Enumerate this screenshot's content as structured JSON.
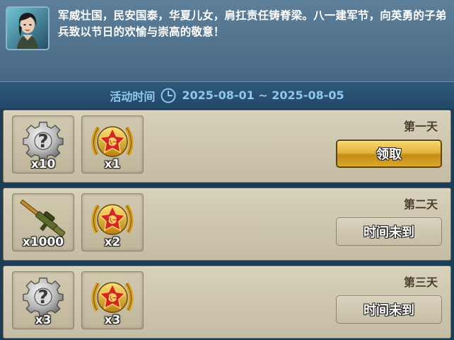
{
  "header": {
    "intro_text": "军威壮国，民安国泰，华夏儿女，肩扛责任铸脊梁。八一建军节，向英勇的子弟兵致以节日的欢愉与崇高的敬意！",
    "period_label": "活动时间",
    "period_value": "2025-08-01 ~ 2025-08-05"
  },
  "rewards": [
    {
      "day": "第一天",
      "items": [
        {
          "icon": "mystery-gear-icon",
          "qty": "x10"
        },
        {
          "icon": "star-medal-icon",
          "qty": "x1"
        }
      ],
      "button": "领取",
      "state": "claimable"
    },
    {
      "day": "第二天",
      "items": [
        {
          "icon": "rifle-icon",
          "qty": "x1000"
        },
        {
          "icon": "star-medal-icon",
          "qty": "x2"
        }
      ],
      "button": "时间未到",
      "state": "locked"
    },
    {
      "day": "第三天",
      "items": [
        {
          "icon": "mystery-gear-icon",
          "qty": "x3"
        },
        {
          "icon": "star-medal-icon",
          "qty": "x3"
        }
      ],
      "button": "时间未到",
      "state": "locked"
    }
  ],
  "colors": {
    "period_text": "#8ec8ee",
    "claim_button": "#e3b63c",
    "panel_bg": "#d8d1bb"
  }
}
